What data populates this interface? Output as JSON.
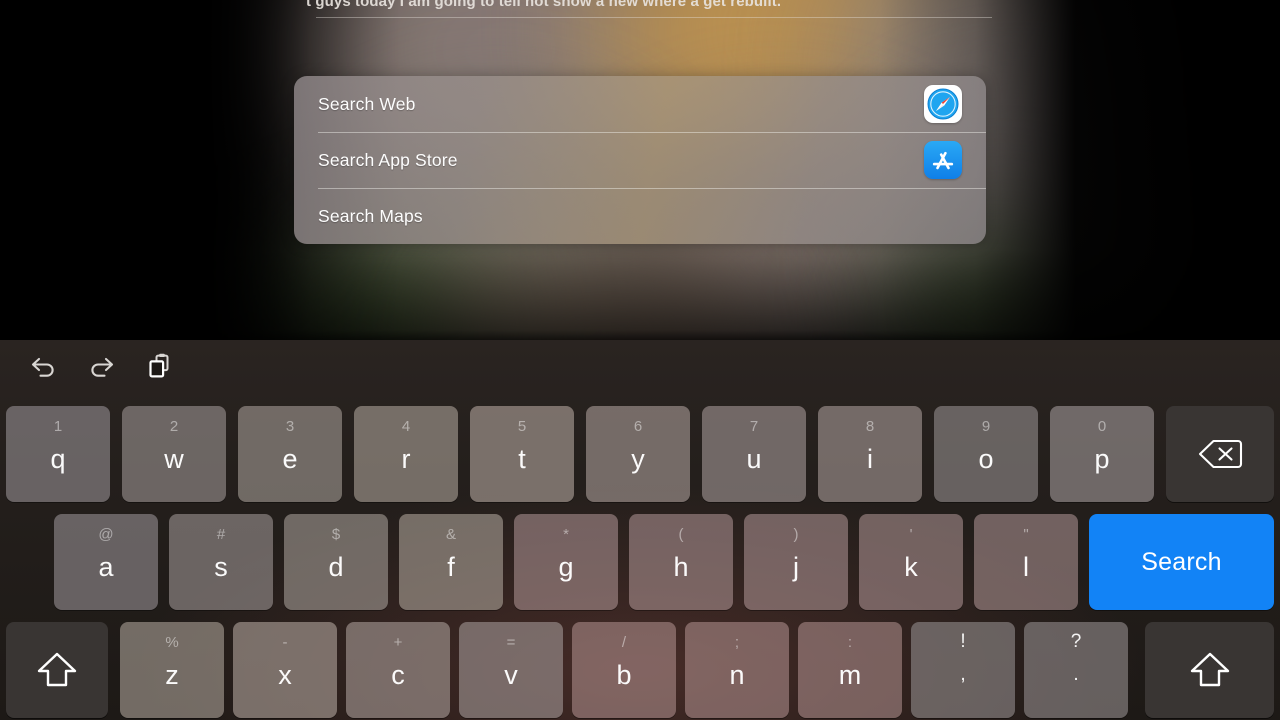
{
  "caption": {
    "text": "t guys today I am going to tell not show a new where a get rebuilt."
  },
  "suggestions": {
    "items": [
      {
        "label": "Search Web",
        "icon": "safari-icon"
      },
      {
        "label": "Search App Store",
        "icon": "app-store-icon"
      },
      {
        "label": "Search Maps",
        "icon": "maps-icon"
      }
    ]
  },
  "keyboard": {
    "toolbar": [
      {
        "name": "undo-icon",
        "label": "Undo"
      },
      {
        "name": "redo-icon",
        "label": "Redo"
      },
      {
        "name": "paste-icon",
        "label": "Paste"
      }
    ],
    "rows": {
      "row1": [
        {
          "alt": "1",
          "main": "q"
        },
        {
          "alt": "2",
          "main": "w"
        },
        {
          "alt": "3",
          "main": "e"
        },
        {
          "alt": "4",
          "main": "r"
        },
        {
          "alt": "5",
          "main": "t"
        },
        {
          "alt": "6",
          "main": "y"
        },
        {
          "alt": "7",
          "main": "u"
        },
        {
          "alt": "8",
          "main": "i"
        },
        {
          "alt": "9",
          "main": "o"
        },
        {
          "alt": "0",
          "main": "p"
        }
      ],
      "row2": [
        {
          "alt": "@",
          "main": "a"
        },
        {
          "alt": "#",
          "main": "s"
        },
        {
          "alt": "$",
          "main": "d"
        },
        {
          "alt": "&",
          "main": "f"
        },
        {
          "alt": "*",
          "main": "g"
        },
        {
          "alt": "(",
          "main": "h"
        },
        {
          "alt": ")",
          "main": "j"
        },
        {
          "alt": "'",
          "main": "k"
        },
        {
          "alt": "\"",
          "main": "l"
        }
      ],
      "row3": [
        {
          "alt": "%",
          "main": "z"
        },
        {
          "alt": "-",
          "main": "x"
        },
        {
          "alt": "+",
          "main": "c"
        },
        {
          "alt": "=",
          "main": "v"
        },
        {
          "alt": "/",
          "main": "b"
        },
        {
          "alt": ";",
          "main": "n"
        },
        {
          "alt": ":",
          "main": "m"
        },
        {
          "alt": "!",
          "main": ","
        },
        {
          "alt": "?",
          "main": "."
        }
      ]
    },
    "backspace": {
      "name": "backspace-key",
      "label": "Backspace"
    },
    "search": {
      "name": "search-key",
      "label": "Search"
    },
    "shift_left": {
      "name": "shift-key-left",
      "label": "Shift"
    },
    "shift_right": {
      "name": "shift-key-right",
      "label": "Shift"
    }
  },
  "colors": {
    "accent": "#1283f6",
    "key_dark": "#393533",
    "key_text": "#ffffff"
  }
}
